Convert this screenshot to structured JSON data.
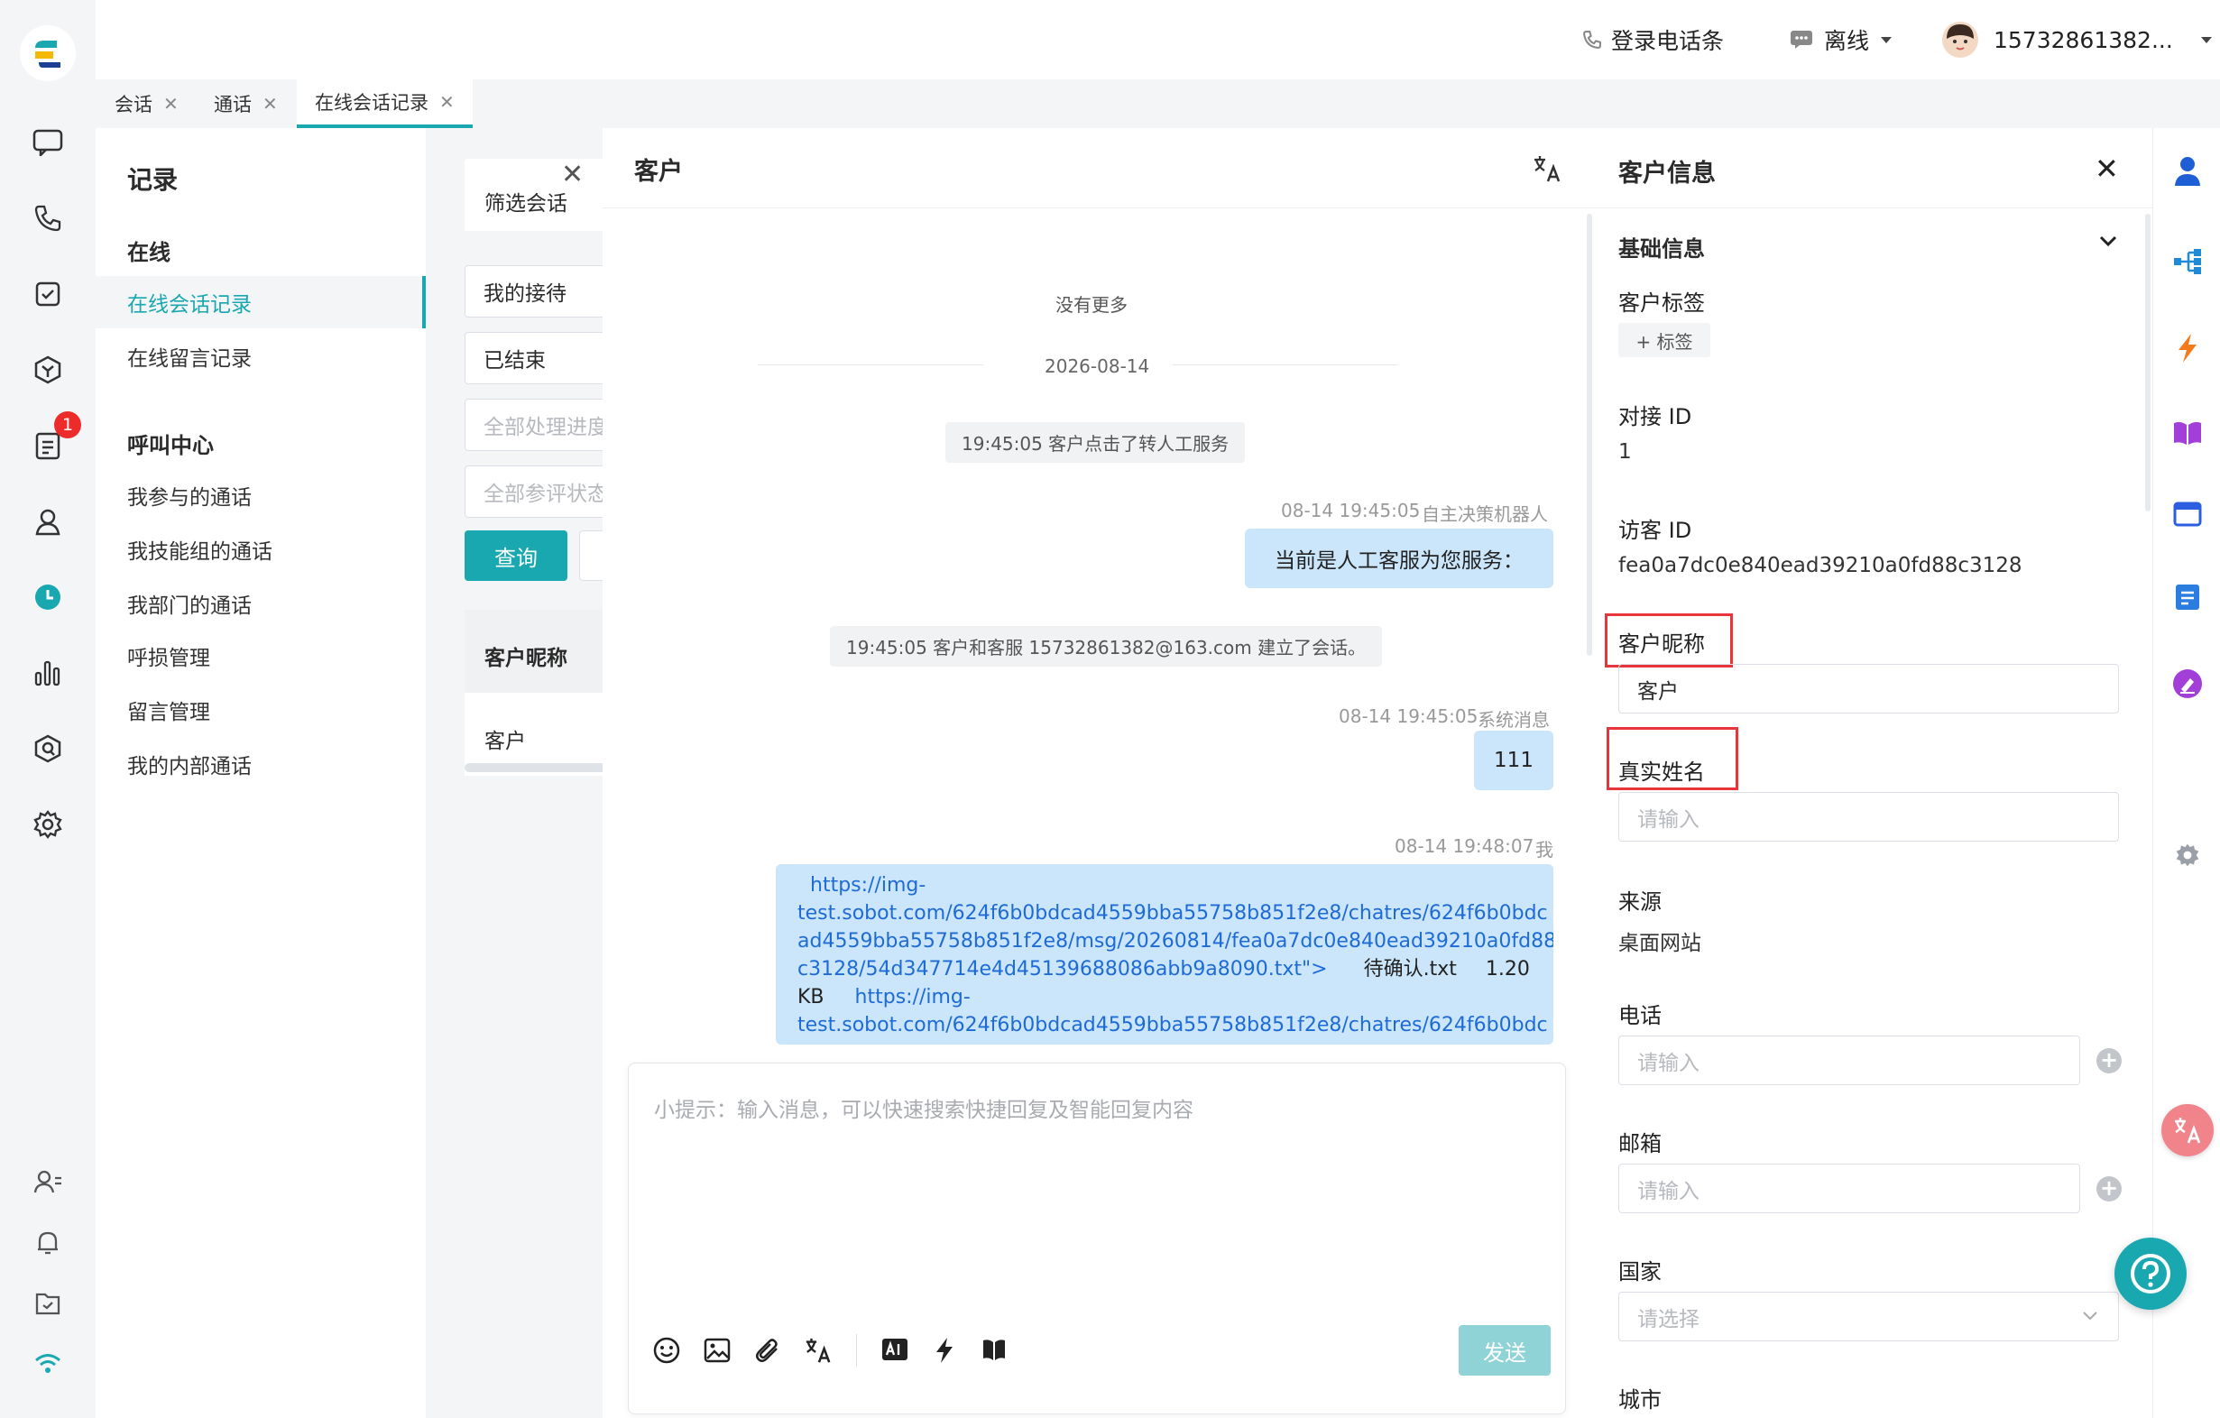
{
  "header": {
    "phone_bar": "登录电话条",
    "status": "离线",
    "user": "15732861382..."
  },
  "tabs": [
    {
      "label": "会话"
    },
    {
      "label": "通话"
    },
    {
      "label": "在线会话记录"
    }
  ],
  "rail": {
    "badge_count": "1"
  },
  "nav": {
    "title": "记录",
    "online_section": "在线",
    "online_items": [
      "在线会话记录",
      "在线留言记录"
    ],
    "call_section": "呼叫中心",
    "call_items": [
      "我参与的通话",
      "我技能组的通话",
      "我部门的通话",
      "呼损管理",
      "留言管理",
      "我的内部通话"
    ]
  },
  "filter": {
    "tab_label": "筛选会话",
    "reception": "我的接待",
    "status": "已结束",
    "progress_placeholder": "全部处理进度",
    "rating_placeholder": "全部参评状态",
    "query_button": "查询",
    "col_header": "客户昵称",
    "row_value": "客户"
  },
  "chat": {
    "title": "客户",
    "no_more": "没有更多",
    "date": "2026-08-14",
    "sys1": "19:45:05 客户点击了转人工服务",
    "msg1_time": "08-14 19:45:05",
    "msg1_sender": "自主决策机器人",
    "msg1_text": "当前是人工客服为您服务：",
    "sys2": "19:45:05 客户和客服 15732861382@163.com 建立了会话。",
    "msg2_time": "08-14 19:45:05",
    "msg2_sender": "系统消息",
    "msg2_text": "111",
    "msg3_time": "08-14 19:48:07",
    "msg3_sender": "我",
    "msg3_link1_a": "https://img-",
    "msg3_link1_b": "test.sobot.com/624f6b0bdcad4559bba55758b851f2e8/chatres/624f6b0bdc",
    "msg3_link1_c": "ad4559bba55758b851f2e8/msg/20260814/fea0a7dc0e840ead39210a0fd88",
    "msg3_link1_d": "c3128/54d347714e4d45139688086abb9a8090.txt\">",
    "msg3_file": "待确认.txt",
    "msg3_size_a": "1.20",
    "msg3_size_b": "KB",
    "msg3_link2_a": "https://img-",
    "msg3_link2_b": "test.sobot.com/624f6b0bdcad4559bba55758b851f2e8/chatres/624f6b0bdc",
    "input_placeholder": "小提示：输入消息，可以快速搜索快捷回复及智能回复内容",
    "send_button": "发送"
  },
  "info": {
    "title": "客户信息",
    "section": "基础信息",
    "tag_label": "客户标签",
    "tag_button": "+ 标签",
    "dock_id_label": "对接 ID",
    "dock_id_value": "1",
    "visitor_id_label": "访客 ID",
    "visitor_id_value": "fea0a7dc0e840ead39210a0fd88c3128",
    "nickname_label": "客户昵称",
    "nickname_value": "客户",
    "realname_label": "真实姓名",
    "realname_placeholder": "请输入",
    "source_label": "来源",
    "source_value": "桌面网站",
    "phone_label": "电话",
    "phone_placeholder": "请输入",
    "email_label": "邮箱",
    "email_placeholder": "请输入",
    "country_label": "国家",
    "country_placeholder": "请选择",
    "city_label": "城市"
  },
  "colors": {
    "accent": "#19a8b0",
    "bubble": "#cbe6fb",
    "highlight": "#e8343b",
    "send_disabled": "#8fd3d6"
  }
}
